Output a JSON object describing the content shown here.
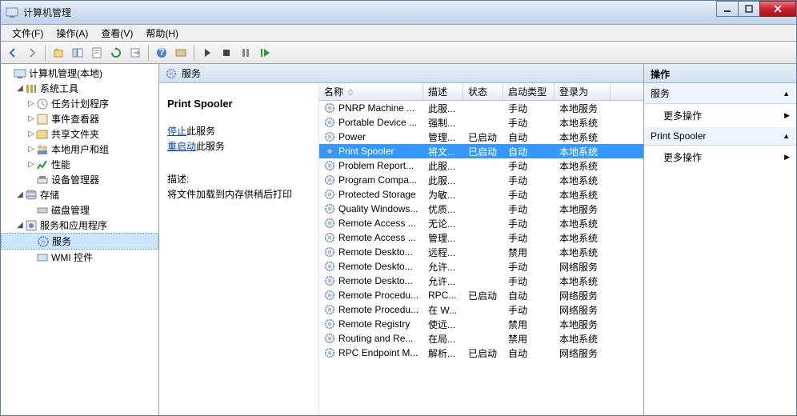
{
  "window": {
    "title": "计算机管理"
  },
  "menu": [
    "文件(F)",
    "操作(A)",
    "查看(V)",
    "帮助(H)"
  ],
  "tree": {
    "root": "计算机管理(本地)",
    "systools": "系统工具",
    "systools_children": [
      "任务计划程序",
      "事件查看器",
      "共享文件夹",
      "本地用户和组",
      "性能",
      "设备管理器"
    ],
    "storage": "存储",
    "storage_children": [
      "磁盘管理"
    ],
    "svcapp": "服务和应用程序",
    "services": "服务",
    "wmi": "WMI 控件"
  },
  "center": {
    "header": "服务",
    "selected_name": "Print Spooler",
    "stop_link": "停止",
    "stop_suffix": "此服务",
    "restart_link": "重启动",
    "restart_suffix": "此服务",
    "desc_hd": "描述:",
    "desc": "将文件加载到内存供稍后打印"
  },
  "columns": {
    "name": "名称",
    "desc": "描述",
    "state": "状态",
    "start": "启动类型",
    "logon": "登录为"
  },
  "services": [
    {
      "name": "PNRP Machine ...",
      "desc": "此服...",
      "state": "",
      "start": "手动",
      "logon": "本地服务"
    },
    {
      "name": "Portable Device ...",
      "desc": "强制...",
      "state": "",
      "start": "手动",
      "logon": "本地系统"
    },
    {
      "name": "Power",
      "desc": "管理...",
      "state": "已启动",
      "start": "自动",
      "logon": "本地系统"
    },
    {
      "name": "Print Spooler",
      "desc": "将文...",
      "state": "已启动",
      "start": "自动",
      "logon": "本地系统",
      "selected": true
    },
    {
      "name": "Problem Report...",
      "desc": "此服...",
      "state": "",
      "start": "手动",
      "logon": "本地系统"
    },
    {
      "name": "Program Compa...",
      "desc": "此服...",
      "state": "",
      "start": "手动",
      "logon": "本地系统"
    },
    {
      "name": "Protected Storage",
      "desc": "为敏...",
      "state": "",
      "start": "手动",
      "logon": "本地系统"
    },
    {
      "name": "Quality Windows...",
      "desc": "优质...",
      "state": "",
      "start": "手动",
      "logon": "本地服务"
    },
    {
      "name": "Remote Access ...",
      "desc": "无论...",
      "state": "",
      "start": "手动",
      "logon": "本地系统"
    },
    {
      "name": "Remote Access ...",
      "desc": "管理...",
      "state": "",
      "start": "手动",
      "logon": "本地系统"
    },
    {
      "name": "Remote Deskto...",
      "desc": "远程...",
      "state": "",
      "start": "禁用",
      "logon": "本地系统"
    },
    {
      "name": "Remote Deskto...",
      "desc": "允许...",
      "state": "",
      "start": "手动",
      "logon": "网络服务"
    },
    {
      "name": "Remote Deskto...",
      "desc": "允许...",
      "state": "",
      "start": "手动",
      "logon": "本地系统"
    },
    {
      "name": "Remote Procedu...",
      "desc": "RPC...",
      "state": "已启动",
      "start": "自动",
      "logon": "网络服务"
    },
    {
      "name": "Remote Procedu...",
      "desc": "在 W...",
      "state": "",
      "start": "手动",
      "logon": "网络服务"
    },
    {
      "name": "Remote Registry",
      "desc": "使远...",
      "state": "",
      "start": "禁用",
      "logon": "本地服务"
    },
    {
      "name": "Routing and Re...",
      "desc": "在局...",
      "state": "",
      "start": "禁用",
      "logon": "本地系统"
    },
    {
      "name": "RPC Endpoint M...",
      "desc": "解析...",
      "state": "已启动",
      "start": "自动",
      "logon": "网络服务"
    }
  ],
  "actions": {
    "header": "操作",
    "group1": "服务",
    "more": "更多操作",
    "group2": "Print Spooler"
  }
}
